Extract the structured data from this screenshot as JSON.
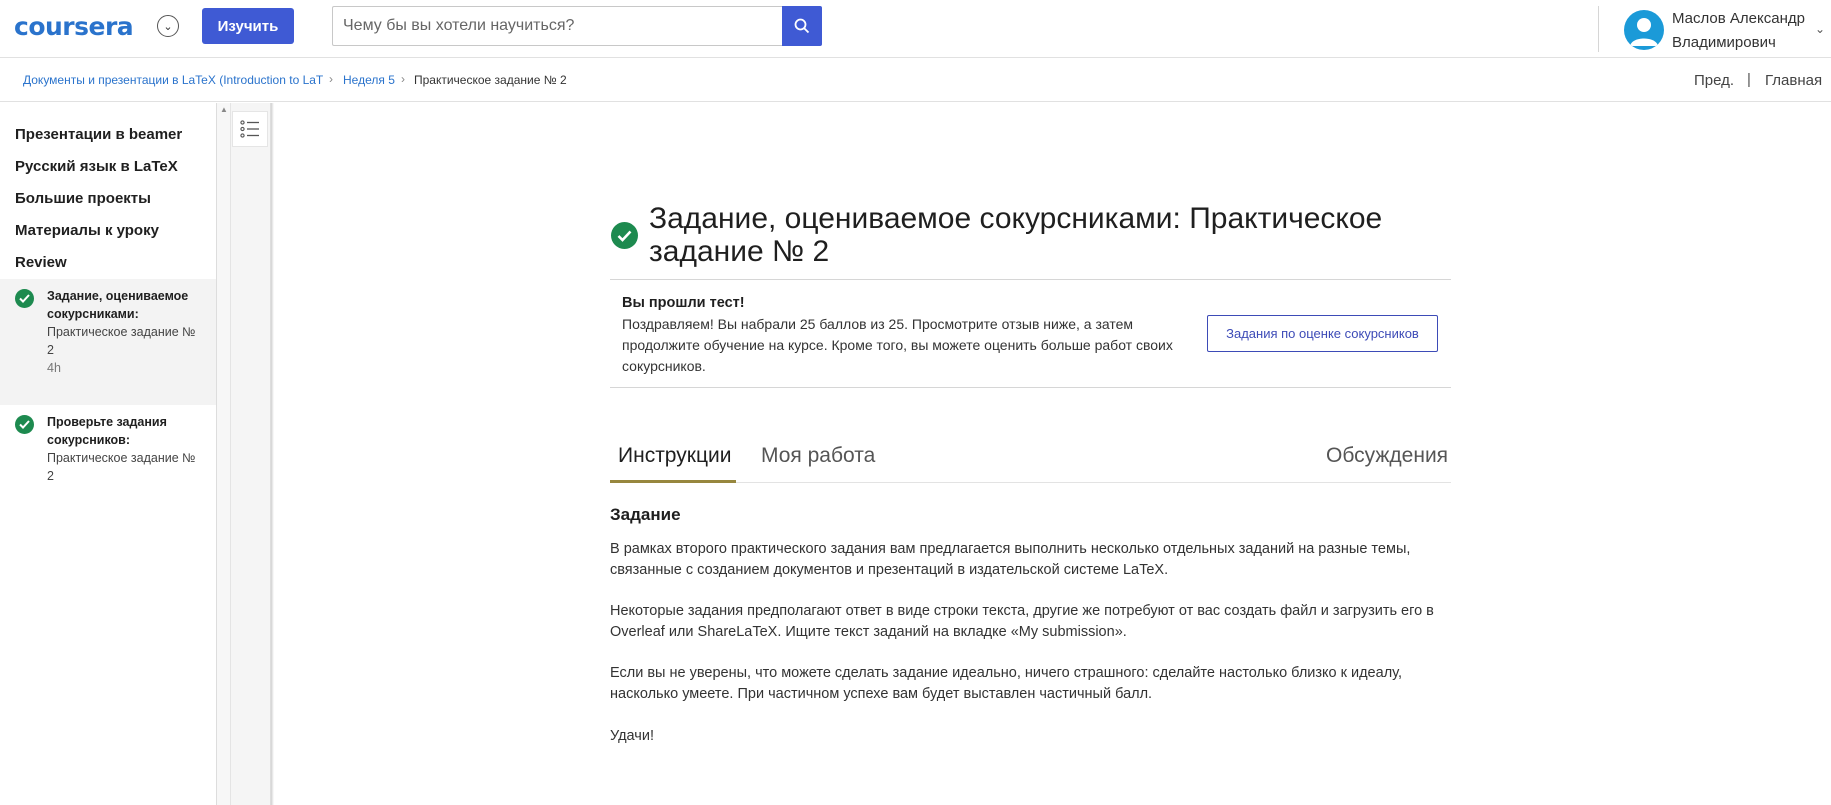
{
  "header": {
    "logo_text": "coursera",
    "explore_label": "Изучить",
    "search_placeholder": "Чему бы вы хотели научиться?",
    "user_name": "Маслов Александр Владимирович"
  },
  "breadcrumb": {
    "items": [
      "Документы и презентации в LaTeX (Introduction to LaT",
      "Неделя 5",
      "Практическое задание № 2"
    ],
    "prev_label": "Пред.",
    "separator": "|",
    "home_label": "Главная"
  },
  "sidebar": {
    "sections": [
      "Презентации в beamer",
      "Русский язык в LaTeX",
      "Большие проекты",
      "Материалы к уроку",
      "Review"
    ],
    "items": [
      {
        "title": "Задание, оцениваемое сокурсниками:",
        "subtitle": "Практическое задание № 2",
        "time": "4h",
        "active": true,
        "completed": true
      },
      {
        "title": "Проверьте задания сокурсников:",
        "subtitle": "Практическое задание № 2",
        "time": "",
        "active": false,
        "completed": true
      }
    ]
  },
  "main": {
    "title": "Задание, оцениваемое сокурсниками: Практическое задание № 2",
    "pass_heading": "Вы прошли тест!",
    "pass_text": "Поздравляем! Вы набрали 25 баллов из 25. Просмотрите отзыв ниже, а затем продолжите обучение на курсе. Кроме того, вы можете оценить больше работ своих сокурсников.",
    "peer_button": "Задания по оценке сокурсников",
    "tabs": [
      "Инструкции",
      "Моя работа",
      "Обсуждения"
    ],
    "section_heading": "Задание",
    "paragraphs": [
      "В рамках второго практического задания вам предлагается выполнить несколько отдельных заданий на разные темы, связанные с созданием документов и презентаций в издательской системе LaTeX.",
      "Некоторые задания предполагают ответ в виде строки текста, другие же потребуют от вас создать файл и загрузить его в Overleaf или ShareLaTeX. Ищите текст заданий на вкладке «My submission».",
      "Если вы не уверены, что можете сделать задание идеально, ничего страшного: сделайте настолько близко к идеалу, насколько умеете. При частичном успехе вам будет выставлен частичный балл.",
      "Удачи!"
    ]
  },
  "colors": {
    "brand_blue": "#2a73cc",
    "button_blue": "#3f5ad4",
    "success_green": "#1d8a4f",
    "tab_underline": "#97873e",
    "avatar_blue": "#1b9ad8"
  }
}
